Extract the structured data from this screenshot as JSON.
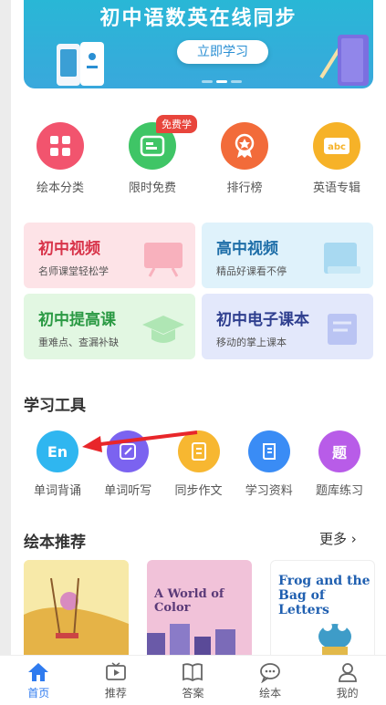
{
  "banner": {
    "title": "初中语数英在线同步",
    "button": "立即学习"
  },
  "quick_links": [
    {
      "label": "绘本分类",
      "icon": "grid-icon",
      "color": "#f2546e"
    },
    {
      "label": "限时免费",
      "icon": "free-icon",
      "color": "#3fc566",
      "badge": "免费学"
    },
    {
      "label": "排行榜",
      "icon": "medal-icon",
      "color": "#f26b3a"
    },
    {
      "label": "英语专辑",
      "icon": "abc-icon",
      "color": "#f6b228"
    }
  ],
  "courses": [
    {
      "title": "初中视频",
      "subtitle": "名师课堂轻松学",
      "title_color": "#d8344a",
      "bg": "#fde3e7"
    },
    {
      "title": "高中视频",
      "subtitle": "精品好课看不停",
      "title_color": "#1e6ea8",
      "bg": "#dff2fb"
    },
    {
      "title": "初中提高课",
      "subtitle": "重难点、查漏补缺",
      "title_color": "#2b9a44",
      "bg": "#e2f7e2"
    },
    {
      "title": "初中电子课本",
      "subtitle": "移动的掌上课本",
      "title_color": "#2f3f8f",
      "bg": "#e3e8fb"
    }
  ],
  "tools_section": {
    "title": "学习工具",
    "items": [
      {
        "label": "单词背诵",
        "glyph": "En",
        "color": "#2fb6f0",
        "icon": "en-icon"
      },
      {
        "label": "单词听写",
        "glyph": "",
        "color": "#7b63f0",
        "icon": "edit-icon"
      },
      {
        "label": "同步作文",
        "glyph": "",
        "color": "#f7b731",
        "icon": "document-icon"
      },
      {
        "label": "学习资料",
        "glyph": "",
        "color": "#3a8cf5",
        "icon": "book-list-icon"
      },
      {
        "label": "题库练习",
        "glyph": "题",
        "color": "#b85ce8",
        "icon": "question-bank-icon"
      }
    ]
  },
  "books_section": {
    "title": "绘本推荐",
    "more": "更多",
    "items": [
      {
        "title": "",
        "bg": "#f7e9a8"
      },
      {
        "title": "A World of Color",
        "bg": "#f1c2d9"
      },
      {
        "title": "Frog and the Bag of Letters",
        "bg": "#ffffff"
      }
    ]
  },
  "nav": [
    {
      "label": "首页",
      "icon": "home-icon",
      "active": true
    },
    {
      "label": "推荐",
      "icon": "tv-icon",
      "active": false
    },
    {
      "label": "答案",
      "icon": "book-icon",
      "active": false
    },
    {
      "label": "绘本",
      "icon": "chat-icon",
      "active": false
    },
    {
      "label": "我的",
      "icon": "user-icon",
      "active": false
    }
  ]
}
